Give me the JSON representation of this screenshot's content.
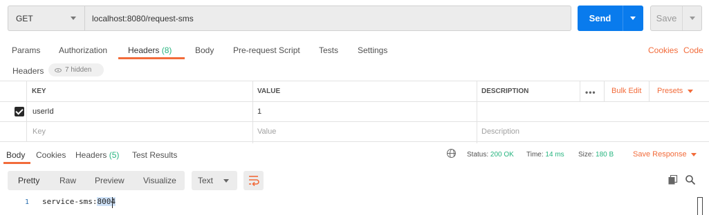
{
  "request": {
    "method": "GET",
    "url": "localhost:8080/request-sms",
    "send_label": "Send",
    "save_label": "Save"
  },
  "request_tabs": {
    "params": "Params",
    "authorization": "Authorization",
    "headers": "Headers",
    "headers_count": "(8)",
    "body": "Body",
    "prerequest": "Pre-request Script",
    "tests": "Tests",
    "settings": "Settings",
    "cookies": "Cookies",
    "code": "Code"
  },
  "headers_section": {
    "title": "Headers",
    "hidden": "7 hidden"
  },
  "headers_table": {
    "columns": {
      "key": "KEY",
      "value": "VALUE",
      "description": "DESCRIPTION"
    },
    "more_label": "•••",
    "bulk_edit": "Bulk Edit",
    "presets": "Presets",
    "rows": [
      {
        "checked": true,
        "key": "userId",
        "value": "1",
        "description": ""
      }
    ],
    "placeholder": {
      "key": "Key",
      "value": "Value",
      "description": "Description"
    }
  },
  "response_tabs": {
    "body": "Body",
    "cookies": "Cookies",
    "headers": "Headers",
    "headers_count": "(5)",
    "test_results": "Test Results"
  },
  "response_status": {
    "status_label": "Status:",
    "status_value": "200 OK",
    "time_label": "Time:",
    "time_value": "14 ms",
    "size_label": "Size:",
    "size_value": "180 B",
    "save_response": "Save Response"
  },
  "view_toolbar": {
    "pretty": "Pretty",
    "raw": "Raw",
    "preview": "Preview",
    "visualize": "Visualize",
    "format": "Text"
  },
  "editor": {
    "line_number": "1",
    "code_prefix": "service-sms:",
    "code_selected": "8004"
  },
  "colors": {
    "accent": "#f26b3a",
    "primary": "#097bed",
    "success": "#26b47f"
  },
  "icons": [
    "chevron-down-icon",
    "eye-icon",
    "checkbox-checked-icon",
    "globe-icon",
    "wrap-lines-icon",
    "copy-icon",
    "search-icon"
  ]
}
